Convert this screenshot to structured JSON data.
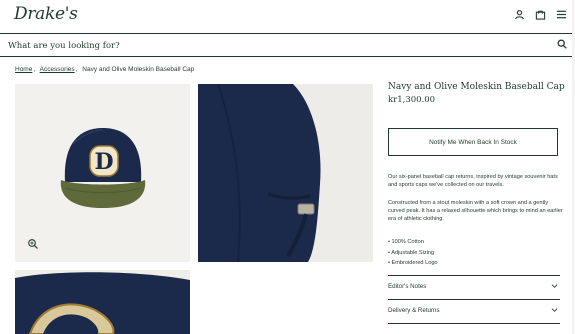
{
  "header": {
    "logo": "Drake's",
    "icons": [
      "account-icon",
      "bag-icon",
      "menu-icon"
    ]
  },
  "search": {
    "placeholder": "What are you looking for?",
    "icon": "search-icon"
  },
  "breadcrumb": {
    "home": "Home",
    "accessories": "Accessories",
    "current": "Navy and Olive Moleskin Baseball Cap"
  },
  "product": {
    "title": "Navy and Olive Moleskin Baseball Cap",
    "price": "kr1,300.00",
    "notify_label": "Notify Me When Back In Stock",
    "desc1": "Our six-panel baseball cap returns, inspired by vintage souvenir hats and sports caps we've collected on our travels.",
    "desc2": "Constructed from a stout moleskin with a soft crown and a gently curved peak. It has a relaxed silhouette which brings to mind an earlier era of athletic clothing.",
    "features": [
      "100% Cotton",
      "Adjustable Sizing",
      "Embroidered Logo"
    ]
  },
  "accordion": [
    {
      "label": "Editor's Notes"
    },
    {
      "label": "Delivery & Returns"
    }
  ],
  "colors": {
    "brand_green": "#1f3a2c",
    "cap_navy": "#1b2a4a",
    "cap_olive": "#5f6a3a"
  }
}
